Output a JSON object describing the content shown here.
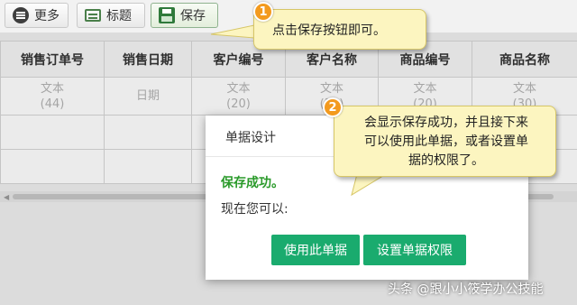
{
  "toolbar": {
    "more_label": "更多",
    "title_label": "标题",
    "save_label": "保存"
  },
  "table": {
    "headers": [
      "销售订单号",
      "销售日期",
      "客户编号",
      "客户名称",
      "商品编号",
      "商品名称"
    ],
    "row1": [
      {
        "line1": "文本",
        "line2": "(44)"
      },
      {
        "line1": "日期",
        "line2": ""
      },
      {
        "line1": "文本",
        "line2": "(20)"
      },
      {
        "line1": "文本",
        "line2": "(30)"
      },
      {
        "line1": "文本",
        "line2": "(20)"
      },
      {
        "line1": "文本",
        "line2": "(30)"
      }
    ]
  },
  "dialog": {
    "title": "单据设计",
    "success_text": "保存成功。",
    "now_text": "现在您可以:",
    "use_button": "使用此单据",
    "permission_button": "设置单据权限"
  },
  "callouts": {
    "c1": {
      "number": "1",
      "text": "点击保存按钮即可。"
    },
    "c2": {
      "number": "2",
      "line1": "会显示保存成功，并且接下来",
      "line2": "可以使用此单据，或者设置单",
      "line3": "据的权限了。"
    }
  },
  "watermark": "头条 @跟小小筱学办公技能",
  "colors": {
    "accent_green": "#1aab6e",
    "success_text": "#2a9a2a",
    "callout_bg": "#fcf5c0",
    "badge_orange": "#f39a1e"
  },
  "icons": [
    "more-icon",
    "title-icon",
    "save-icon"
  ]
}
